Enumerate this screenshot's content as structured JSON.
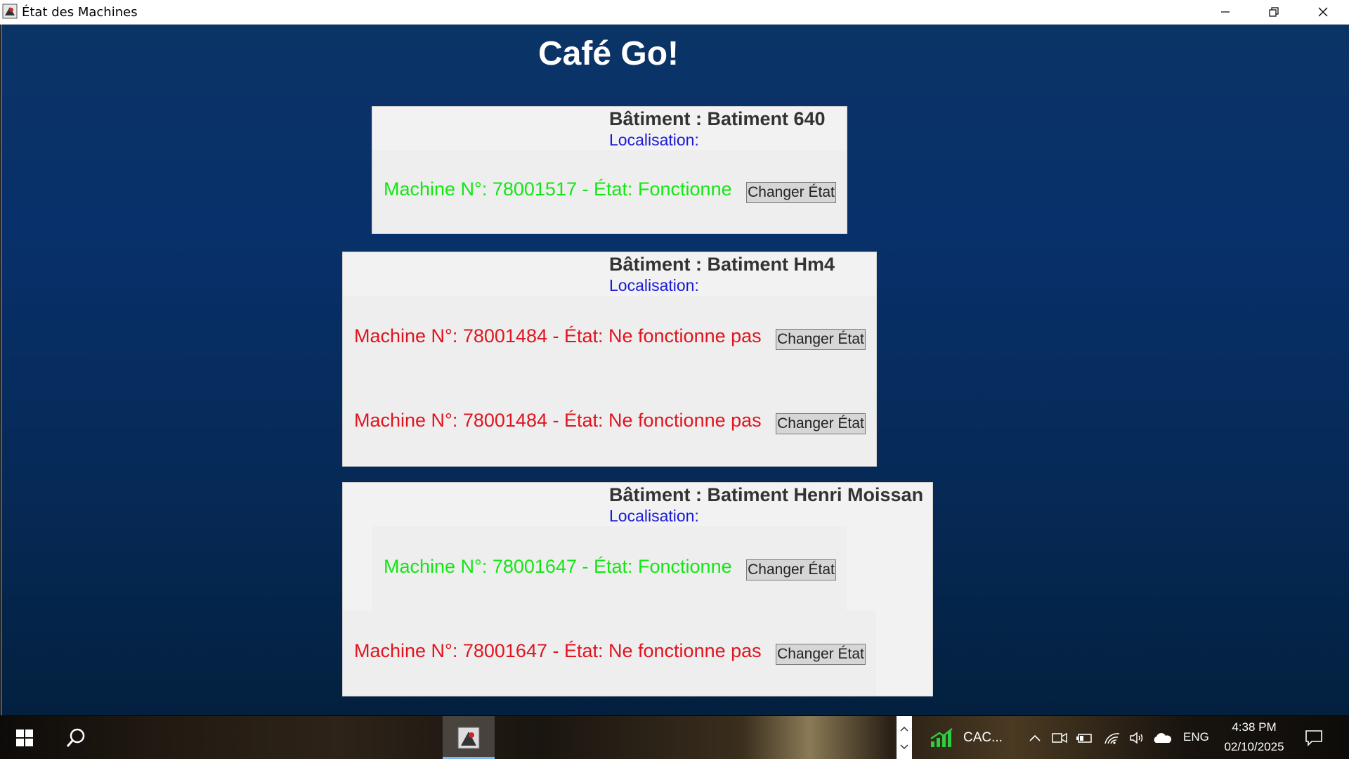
{
  "window": {
    "title": "État des Machines",
    "controls": [
      "minimize",
      "restore",
      "close"
    ]
  },
  "app": {
    "title": "Café Go!"
  },
  "buildings": [
    {
      "heading": "Bâtiment : Batiment 640",
      "location_label": "Localisation:",
      "machines": [
        {
          "text": "Machine N°: 78001517 - État: Fonctionne",
          "status": "ok",
          "button": "Changer État"
        }
      ]
    },
    {
      "heading": "Bâtiment : Batiment Hm4",
      "location_label": "Localisation:",
      "machines": [
        {
          "text": "Machine N°: 78001484 - État: Ne fonctionne pas",
          "status": "ko",
          "button": "Changer État"
        },
        {
          "text": "Machine N°: 78001484 - État: Ne fonctionne pas",
          "status": "ko",
          "button": "Changer État"
        }
      ]
    },
    {
      "heading": "Bâtiment : Batiment Henri Moissan",
      "location_label": "Localisation:",
      "machines": [
        {
          "text": "Machine N°: 78001647 - État: Fonctionne",
          "status": "ok",
          "button": "Changer État"
        },
        {
          "text": "Machine N°: 78001647 - État: Ne fonctionne pas",
          "status": "ko",
          "button": "Changer État"
        }
      ]
    }
  ],
  "colors": {
    "ok": "#14e614",
    "ko": "#e0141e",
    "location": "#1a1ad6",
    "background_top": "#0b3466",
    "background_bottom": "#03203f"
  },
  "taskbar": {
    "widget_label": "CAC...",
    "language": "ENG",
    "time": "4:38 PM",
    "date": "02/10/2025",
    "icons": [
      "start-icon",
      "search-icon",
      "java-app-icon",
      "scroll-up-icon",
      "scroll-down-icon",
      "stock-chart-icon",
      "chevron-up-icon",
      "meet-icon",
      "battery-icon",
      "wifi-icon",
      "volume-icon",
      "onedrive-icon",
      "notification-icon"
    ]
  }
}
